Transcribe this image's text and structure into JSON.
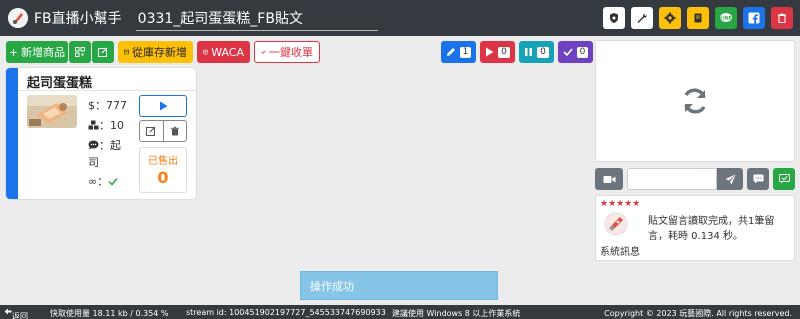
{
  "header": {
    "app_title": "FB直播小幫手",
    "document_title": "0331_起司蛋蛋糕_FB貼文",
    "icons": [
      "shield-icon",
      "wrench-icon",
      "gear-icon",
      "book-icon",
      "line-icon",
      "facebook-icon",
      "trash-icon"
    ]
  },
  "toolbar": {
    "add_product": "新增商品",
    "add_from_stock": "從庫存新增",
    "waca": "WACA",
    "one_click_close": "一鍵收單"
  },
  "counters": [
    {
      "name": "edit",
      "value": "1",
      "color": "#1a73e8"
    },
    {
      "name": "play",
      "value": "0",
      "color": "#dc3545"
    },
    {
      "name": "pause",
      "value": "0",
      "color": "#17a2b8"
    },
    {
      "name": "check",
      "value": "0",
      "color": "#6f42c1"
    }
  ],
  "product": {
    "name": "起司蛋蛋糕",
    "price_label": "$：777",
    "stock_label": "：10",
    "keyword_label": "：起",
    "keyword_cont": "司",
    "unlimited_label": "∞：",
    "sold_label": "已售出",
    "sold_value": "0"
  },
  "message": {
    "stars": "★★★★★",
    "text": "貼文留言讀取完成，共1筆留言，耗時 0.134 秒。",
    "sender": "系統訊息"
  },
  "toast": "操作成功",
  "footer": {
    "back": "返回",
    "usage": "快取使用量 18.11 kb / 0.354 %",
    "stream": "stream id: 100451902197727_545533747690933",
    "suggest": "建議使用 Windows 8 以上作業系統",
    "copyright": "Copyright © 2023 玩藝國際. All rights reserved."
  }
}
